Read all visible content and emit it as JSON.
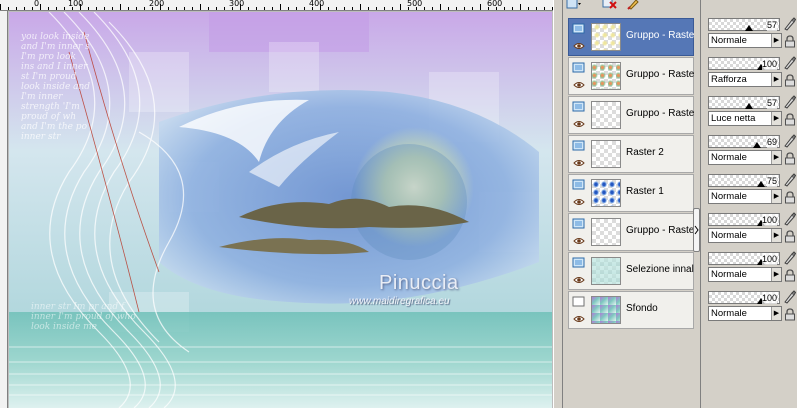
{
  "ruler": {
    "marks": [
      "0",
      "100",
      "200",
      "300",
      "400",
      "500",
      "600"
    ]
  },
  "artwork": {
    "watermark_title": "Pinuccia",
    "watermark_url": "www.maidiregrafica.eu",
    "poem_top": "you look inside and I'm inner s I'm pro look ins and I inner st I'm proud look inside and I'm inner strength 'I'm proud of wh and I'm the po inner str",
    "poem_bottom": "inner str Im pr and f inner I'm proud of who look inside me"
  },
  "layers_toolbar": {
    "items": [
      "layer-menu-icon",
      "delete-icon",
      "edit-brush-icon"
    ]
  },
  "layers": [
    {
      "name": "Gruppo - Raster",
      "selected": true,
      "thumb": "faint-yellow",
      "vis": "group-icon"
    },
    {
      "name": "Gruppo - Raster",
      "selected": false,
      "thumb": "orange-green",
      "vis": "group-icon"
    },
    {
      "name": "Gruppo - Raster",
      "selected": false,
      "thumb": "empty",
      "vis": "group-icon"
    },
    {
      "name": "Raster 2",
      "selected": false,
      "thumb": "empty",
      "vis": "raster-icon"
    },
    {
      "name": "Raster 1",
      "selected": false,
      "thumb": "blue-blob",
      "vis": "raster-icon"
    },
    {
      "name": "Gruppo - Raster",
      "selected": false,
      "thumb": "empty",
      "vis": "group-icon"
    },
    {
      "name": "Selezione innalz",
      "selected": false,
      "thumb": "light-teal",
      "vis": "raster-icon"
    },
    {
      "name": "Sfondo",
      "selected": false,
      "thumb": "purple-teal",
      "vis": "background-icon"
    }
  ],
  "properties": [
    {
      "opacity": "57",
      "blend": "Normale"
    },
    {
      "opacity": "100",
      "blend": "Rafforza"
    },
    {
      "opacity": "57",
      "blend": "Luce netta"
    },
    {
      "opacity": "69",
      "blend": "Normale"
    },
    {
      "opacity": "75",
      "blend": "Normale"
    },
    {
      "opacity": "100",
      "blend": "Normale"
    },
    {
      "opacity": "100",
      "blend": "Normale"
    },
    {
      "opacity": "100",
      "blend": "Normale"
    }
  ],
  "colors": {
    "selected_row": "#5577b6",
    "panel_bg": "#d4d0c8"
  }
}
